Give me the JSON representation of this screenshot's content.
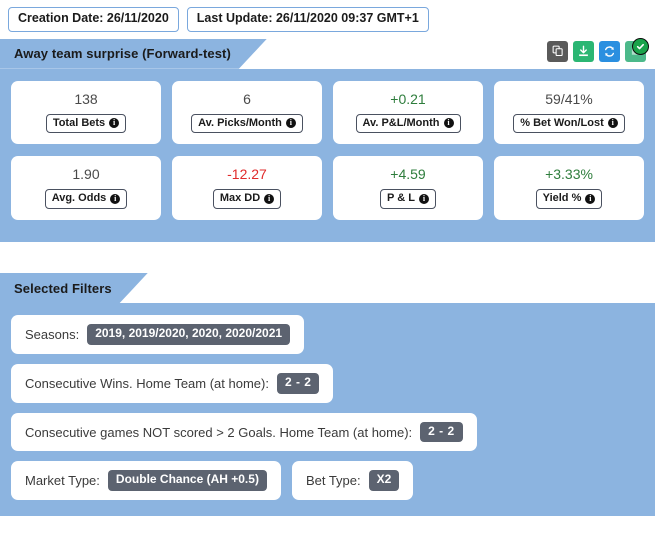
{
  "colors": {
    "panel_blue": "#8cb4e0",
    "pill_grey": "#5c6370",
    "positive_green": "#2e7d3c",
    "negative_red": "#e02b2b",
    "check_green": "#19a34a"
  },
  "top_bar": {
    "creation_date": "Creation Date: 26/11/2020",
    "last_update": "Last Update: 26/11/2020 09:37 GMT+1"
  },
  "stats_section": {
    "ribbon_title": "Away team surprise (Forward-test)",
    "actions": [
      {
        "name": "copy-icon",
        "tooltip": "Copy"
      },
      {
        "name": "download-icon",
        "tooltip": "Download"
      },
      {
        "name": "refresh-icon",
        "tooltip": "Refresh"
      },
      {
        "name": "verified-icon",
        "tooltip": "Verified"
      }
    ],
    "rows": [
      [
        {
          "value": "138",
          "tone": "neutral",
          "label": "Total Bets"
        },
        {
          "value": "6",
          "tone": "neutral",
          "label": "Av. Picks/Month"
        },
        {
          "value": "+0.21",
          "tone": "positive",
          "label": "Av. P&L/Month"
        },
        {
          "value": "59/41%",
          "tone": "neutral",
          "label": "% Bet Won/Lost"
        }
      ],
      [
        {
          "value": "1.90",
          "tone": "neutral",
          "label": "Avg. Odds"
        },
        {
          "value": "-12.27",
          "tone": "negative",
          "label": "Max DD"
        },
        {
          "value": "+4.59",
          "tone": "positive",
          "label": "P & L"
        },
        {
          "value": "+3.33%",
          "tone": "positive",
          "label": "Yield %"
        }
      ]
    ]
  },
  "filters_section": {
    "ribbon_title": "Selected Filters",
    "rows": [
      [
        {
          "label": "Seasons:",
          "pill": "2019, 2019/2020, 2020, 2020/2021"
        }
      ],
      [
        {
          "label": "Consecutive Wins. Home Team (at home):",
          "pill": "2 - 2"
        }
      ],
      [
        {
          "label": "Consecutive games NOT scored > 2 Goals. Home Team (at home):",
          "pill": "2 - 2"
        }
      ],
      [
        {
          "label": "Market Type:",
          "pill": "Double Chance (AH +0.5)"
        },
        {
          "label": "Bet Type:",
          "pill": "X2"
        }
      ]
    ]
  }
}
